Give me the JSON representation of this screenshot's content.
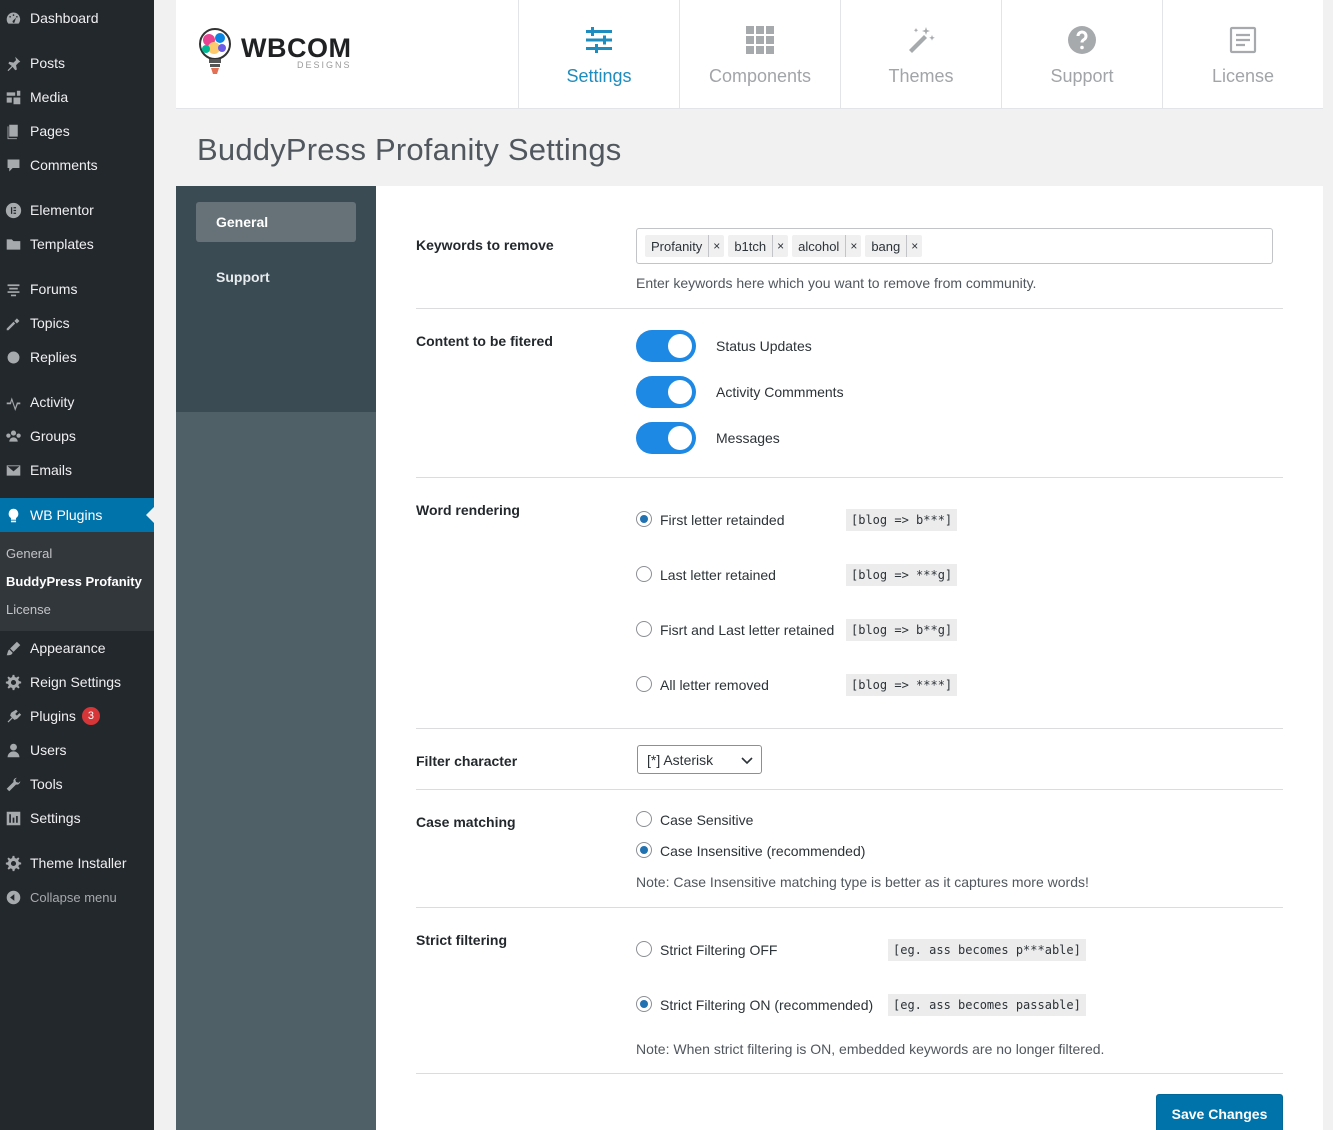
{
  "admin_menu": {
    "items": [
      {
        "label": "Dashboard",
        "icon": "dashboard-icon"
      },
      {
        "label": "Posts",
        "icon": "pushpin-icon"
      },
      {
        "label": "Media",
        "icon": "media-icon"
      },
      {
        "label": "Pages",
        "icon": "pages-icon"
      },
      {
        "label": "Comments",
        "icon": "comment-icon"
      },
      {
        "label": "Elementor",
        "icon": "elementor-icon"
      },
      {
        "label": "Templates",
        "icon": "folder-icon"
      },
      {
        "label": "Forums",
        "icon": "forums-icon"
      },
      {
        "label": "Topics",
        "icon": "topics-icon"
      },
      {
        "label": "Replies",
        "icon": "replies-icon"
      },
      {
        "label": "Activity",
        "icon": "activity-icon"
      },
      {
        "label": "Groups",
        "icon": "groups-icon"
      },
      {
        "label": "Emails",
        "icon": "email-icon"
      },
      {
        "label": "WB Plugins",
        "icon": "lightbulb-icon"
      },
      {
        "label": "Appearance",
        "icon": "brush-icon"
      },
      {
        "label": "Reign Settings",
        "icon": "gear-icon"
      },
      {
        "label": "Plugins",
        "icon": "plugin-icon",
        "badge": "3"
      },
      {
        "label": "Users",
        "icon": "user-icon"
      },
      {
        "label": "Tools",
        "icon": "wrench-icon"
      },
      {
        "label": "Settings",
        "icon": "settings-icon"
      },
      {
        "label": "Theme Installer",
        "icon": "gear-icon"
      },
      {
        "label": "Collapse menu",
        "icon": "collapse-icon"
      }
    ],
    "submenu": [
      "General",
      "BuddyPress Profanity",
      "License"
    ]
  },
  "header": {
    "logo_brand": "WBCOM",
    "logo_sub": "DESIGNS",
    "tabs": [
      {
        "label": "Settings",
        "icon": "sliders-icon"
      },
      {
        "label": "Components",
        "icon": "grid-icon"
      },
      {
        "label": "Themes",
        "icon": "magic-wand-icon"
      },
      {
        "label": "Support",
        "icon": "question-icon"
      },
      {
        "label": "License",
        "icon": "license-icon"
      }
    ]
  },
  "page_title": "BuddyPress Profanity Settings",
  "settings_nav": [
    "General",
    "Support"
  ],
  "form": {
    "keywords": {
      "label": "Keywords to remove",
      "tags": [
        "Profanity",
        "b1tch",
        "alcohol",
        "bang"
      ],
      "remove_glyph": "×",
      "description": "Enter keywords here which you want to remove from community."
    },
    "content": {
      "label": "Content to be fitered",
      "toggles": [
        {
          "label": "Status Updates",
          "on": true
        },
        {
          "label": "Activity Commments",
          "on": true
        },
        {
          "label": "Messages",
          "on": true
        }
      ]
    },
    "rendering": {
      "label": "Word rendering",
      "options": [
        {
          "label": "First letter retainded",
          "example": "[blog => b***]",
          "checked": true
        },
        {
          "label": "Last letter retained",
          "example": "[blog => ***g]",
          "checked": false
        },
        {
          "label": "Fisrt and Last letter retained",
          "example": "[blog => b**g]",
          "checked": false
        },
        {
          "label": "All letter removed",
          "example": "[blog => ****]",
          "checked": false
        }
      ]
    },
    "filter_char": {
      "label": "Filter character",
      "selected": "[*] Asterisk"
    },
    "case": {
      "label": "Case matching",
      "options": [
        {
          "label": "Case Sensitive",
          "checked": false
        },
        {
          "label": "Case Insensitive (recommended)",
          "checked": true
        }
      ],
      "note": "Note: Case Insensitive matching type is better as it captures more words!"
    },
    "strict": {
      "label": "Strict filtering",
      "options": [
        {
          "label": "Strict Filtering OFF",
          "example": "[eg. ass becomes p***able]",
          "checked": false
        },
        {
          "label": "Strict Filtering ON (recommended)",
          "example": "[eg. ass becomes passable]",
          "checked": true
        }
      ],
      "note": "Note: When strict filtering is ON, embedded keywords are no longer filtered."
    },
    "save_label": "Save Changes"
  },
  "colors": {
    "admin_bg": "#23282d",
    "admin_active": "#0073aa",
    "settings_nav_bg": "#4f6067",
    "toggle_on": "#1e88e5",
    "tab_active": "#1e8cbe"
  }
}
